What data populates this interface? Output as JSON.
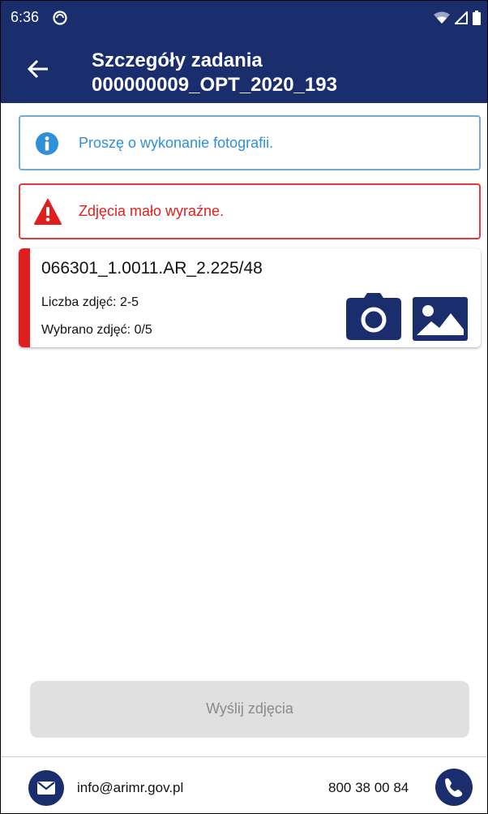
{
  "status_bar": {
    "time": "6:36",
    "icons": [
      "vpn-icon",
      "wifi-icon",
      "signal-icon",
      "battery-icon"
    ]
  },
  "app_bar": {
    "title": "Szczegóły zadania",
    "subtitle": "000000009_OPT_2020_193",
    "back_icon": "arrow-left-icon"
  },
  "info_message": {
    "text": "Proszę o wykonanie fotografii.",
    "icon": "info-icon",
    "color": "#2f8fd8"
  },
  "warning_message": {
    "text": "Zdjęcia mało wyraźne.",
    "icon": "warning-icon",
    "color": "#e02020"
  },
  "task_card": {
    "title": "066301_1.0011.AR_2.225/48",
    "photo_count": "Liczba zdjęć: 2-5",
    "selected": "Wybrano zdjęć: 0/5",
    "status_color": "#e01e1e",
    "camera_icon": "camera-icon",
    "gallery_icon": "image-icon"
  },
  "send_button": {
    "label": "Wyślij zdjęcia",
    "enabled": false
  },
  "footer": {
    "email": "info@arimr.gov.pl",
    "phone": "800 38 00 84",
    "email_icon": "mail-icon",
    "phone_icon": "phone-icon"
  },
  "colors": {
    "primary": "#1a2e6e",
    "info_border": "#6fa9e0",
    "warning_border": "#e53935"
  }
}
